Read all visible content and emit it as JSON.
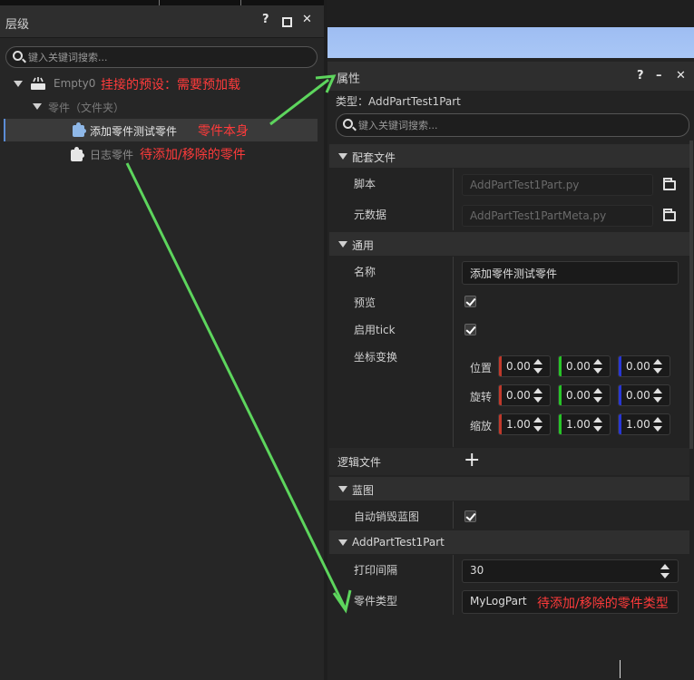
{
  "hierarchy": {
    "title": "层级",
    "help": "?",
    "close": "✕",
    "search_placeholder": "键入关键词搜索...",
    "nodes": [
      {
        "label": "Empty0"
      },
      {
        "label": "零件（文件夹）"
      },
      {
        "label": "添加零件测试零件"
      },
      {
        "label": "日志零件"
      }
    ]
  },
  "annotations": {
    "preset": "挂接的预设：需要预加载",
    "part_itself": "零件本身",
    "to_add": "待添加/移除的零件",
    "part_type": "待添加/移除的零件类型"
  },
  "properties": {
    "title": "属性",
    "help": "?",
    "minimize": "–",
    "close": "✕",
    "type_line": "类型：AddPartTest1Part",
    "search_placeholder": "键入关键词搜索...",
    "sections": {
      "config": "配套文件",
      "general": "通用",
      "blueprint": "蓝图",
      "component": "AddPartTest1Part"
    },
    "config": {
      "script_label": "脚本",
      "script_value": "AddPartTest1Part.py",
      "meta_label": "元数据",
      "meta_value": "AddPartTest1PartMeta.py"
    },
    "general": {
      "name_label": "名称",
      "name_value": "添加零件测试零件",
      "preview_label": "预览",
      "tick_label": "启用tick",
      "transform_label": "坐标变换",
      "position_label": "位置",
      "rotation_label": "旋转",
      "scale_label": "缩放",
      "position": [
        "0.00",
        "0.00",
        "0.00"
      ],
      "rotation": [
        "0.00",
        "0.00",
        "0.00"
      ],
      "scale": [
        "1.00",
        "1.00",
        "1.00"
      ]
    },
    "logic_label": "逻辑文件",
    "logic_add": "+",
    "blueprint": {
      "auto_destroy_label": "自动销毁蓝图"
    },
    "component": {
      "interval_label": "打印间隔",
      "interval_value": "30",
      "part_type_label": "零件类型",
      "part_type_value": "MyLogPart"
    }
  },
  "colors": {
    "annotation": "#ff3b3b",
    "arrow": "#5dd55d",
    "x_axis": "#c0392b",
    "y_axis": "#27c427",
    "z_axis": "#2836d6",
    "selected_part_icon": "#8fb8e8"
  },
  "icons": [
    "search-icon",
    "folder-icon",
    "puzzle-icon",
    "checkbox-icon",
    "chevron-down-icon",
    "maximize-icon",
    "close-icon",
    "help-icon"
  ]
}
